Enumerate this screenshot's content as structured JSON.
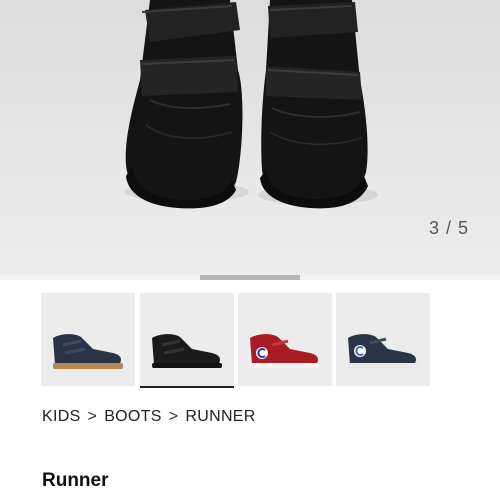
{
  "gallery": {
    "counter": "3 / 5",
    "current_index": 3,
    "total": 5,
    "thumbnails": [
      {
        "color": "navy-brown-sole"
      },
      {
        "color": "black",
        "active": true
      },
      {
        "color": "red"
      },
      {
        "color": "navy-white-sole"
      }
    ]
  },
  "breadcrumb": {
    "items": [
      "KIDS",
      "BOOTS",
      "RUNNER"
    ],
    "separator": ">"
  },
  "product": {
    "title": "Runner"
  },
  "colors": {
    "accent": "#222222",
    "shoe_black": "#1b1b1b",
    "shoe_navy": "#2a3447",
    "shoe_red": "#a81d24"
  }
}
